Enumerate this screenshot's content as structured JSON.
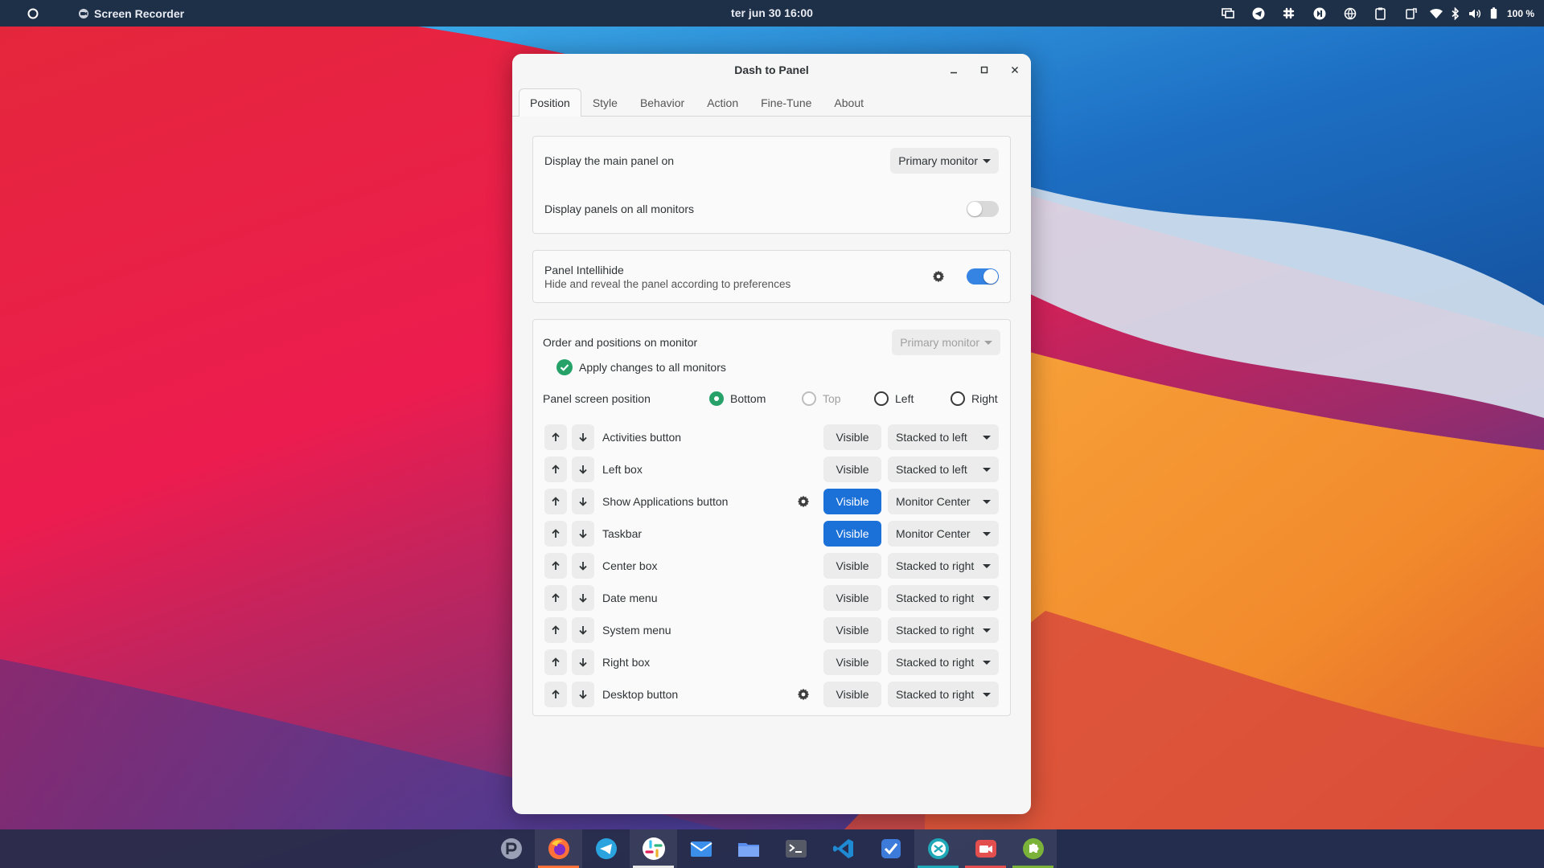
{
  "topbar": {
    "app_name": "Screen Recorder",
    "clock": "ter jun 30  16:00",
    "battery": "100 %"
  },
  "window": {
    "title": "Dash to Panel",
    "tabs": [
      "Position",
      "Style",
      "Behavior",
      "Action",
      "Fine-Tune",
      "About"
    ],
    "active_tab": "Position"
  },
  "monitors": {
    "display_main_label": "Display the main panel on",
    "display_main_value": "Primary monitor",
    "all_monitors_label": "Display panels on all monitors",
    "all_monitors_on": false
  },
  "intellihide": {
    "title": "Panel Intellihide",
    "subtitle": "Hide and reveal the panel according to preferences",
    "on": true
  },
  "order": {
    "label": "Order and positions on monitor",
    "monitor_value": "Primary monitor",
    "apply_all_label": "Apply changes to all monitors",
    "position_label": "Panel screen position",
    "positions": {
      "bottom": "Bottom",
      "top": "Top",
      "left": "Left",
      "right": "Right"
    },
    "selected_position": "Bottom",
    "visible_label": "Visible",
    "items": [
      {
        "label": "Activities button",
        "visible_on": false,
        "position": "Stacked to left",
        "gear": false
      },
      {
        "label": "Left box",
        "visible_on": false,
        "position": "Stacked to left",
        "gear": false
      },
      {
        "label": "Show Applications button",
        "visible_on": true,
        "position": "Monitor Center",
        "gear": true
      },
      {
        "label": "Taskbar",
        "visible_on": true,
        "position": "Monitor Center",
        "gear": false
      },
      {
        "label": "Center box",
        "visible_on": false,
        "position": "Stacked to right",
        "gear": false
      },
      {
        "label": "Date menu",
        "visible_on": false,
        "position": "Stacked to right",
        "gear": false
      },
      {
        "label": "System menu",
        "visible_on": false,
        "position": "Stacked to right",
        "gear": false
      },
      {
        "label": "Right box",
        "visible_on": false,
        "position": "Stacked to right",
        "gear": false
      },
      {
        "label": "Desktop button",
        "visible_on": false,
        "position": "Stacked to right",
        "gear": true
      }
    ]
  },
  "dock": [
    {
      "name": "pop-shop-icon",
      "color": "#9aa0b5"
    },
    {
      "name": "firefox-icon",
      "color": "#ff7139",
      "running": true
    },
    {
      "name": "telegram-icon",
      "color": "#2aa3df"
    },
    {
      "name": "slack-icon",
      "color": "#ffffff",
      "running": true
    },
    {
      "name": "mail-icon",
      "color": "#3b8eea"
    },
    {
      "name": "files-icon",
      "color": "#5b8def"
    },
    {
      "name": "terminal-icon",
      "color": "#555a66"
    },
    {
      "name": "vscode-icon",
      "color": "#1f8ad2"
    },
    {
      "name": "todo-icon",
      "color": "#3d7bdb"
    },
    {
      "name": "remmina-icon",
      "color": "#1fa8b8",
      "running": true
    },
    {
      "name": "screen-recorder-icon",
      "color": "#e34f4f",
      "running": true
    },
    {
      "name": "extensions-icon",
      "color": "#7bb33a",
      "running": true
    }
  ],
  "colors": {
    "accent": "#1c71d8",
    "switch_on": "#3584e4",
    "check_green": "#26a269",
    "topbar_bg": "#1e2f48"
  }
}
